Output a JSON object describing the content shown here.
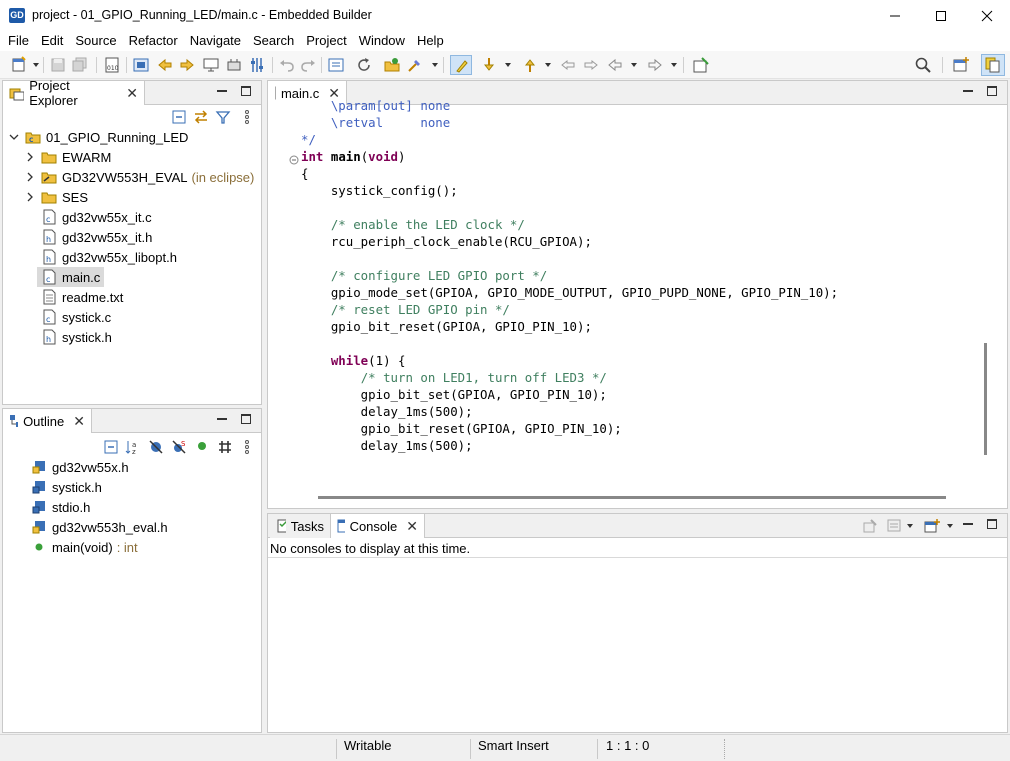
{
  "window": {
    "app_icon_text": "GD",
    "title": "project - 01_GPIO_Running_LED/main.c - Embedded Builder"
  },
  "menu": [
    "File",
    "Edit",
    "Source",
    "Refactor",
    "Navigate",
    "Search",
    "Project",
    "Window",
    "Help"
  ],
  "project_explorer": {
    "tab_label": "Project Explorer",
    "items": [
      {
        "label": "01_GPIO_Running_LED",
        "icon": "project-icon",
        "expanded": true
      },
      {
        "label": "EWARM",
        "icon": "folder-icon"
      },
      {
        "label": "GD32VW553H_EVAL",
        "decoration": "(in eclipse)",
        "icon": "linked-folder-icon"
      },
      {
        "label": "SES",
        "icon": "folder-icon"
      },
      {
        "label": "gd32vw55x_it.c",
        "icon": "c-file-icon"
      },
      {
        "label": "gd32vw55x_it.h",
        "icon": "h-file-icon"
      },
      {
        "label": "gd32vw55x_libopt.h",
        "icon": "h-file-icon"
      },
      {
        "label": "main.c",
        "icon": "c-file-icon",
        "selected": true
      },
      {
        "label": "readme.txt",
        "icon": "text-file-icon"
      },
      {
        "label": "systick.c",
        "icon": "c-file-icon"
      },
      {
        "label": "systick.h",
        "icon": "h-file-icon"
      }
    ]
  },
  "outline": {
    "tab_label": "Outline",
    "items": [
      {
        "label": "gd32vw55x.h",
        "icon": "include-icon"
      },
      {
        "label": "systick.h",
        "icon": "include-icon"
      },
      {
        "label": "stdio.h",
        "icon": "include-icon"
      },
      {
        "label": "gd32vw553h_eval.h",
        "icon": "include-icon"
      },
      {
        "label": "main(void)",
        "type": ": int",
        "icon": "function-icon"
      }
    ]
  },
  "editor": {
    "tab_label": "main.c"
  },
  "bottom_panel": {
    "tasks_tab": "Tasks",
    "console_tab": "Console",
    "message": "No consoles to display at this time."
  },
  "status": {
    "writable": "Writable",
    "insert_mode": "Smart Insert",
    "position": "1 : 1 : 0"
  },
  "colors": {
    "keyword": "#7f0055",
    "comment": "#3f7f5f",
    "doc_comment": "#3f5fbf",
    "selection": "#dadada",
    "accent": "#1e5aa8"
  }
}
